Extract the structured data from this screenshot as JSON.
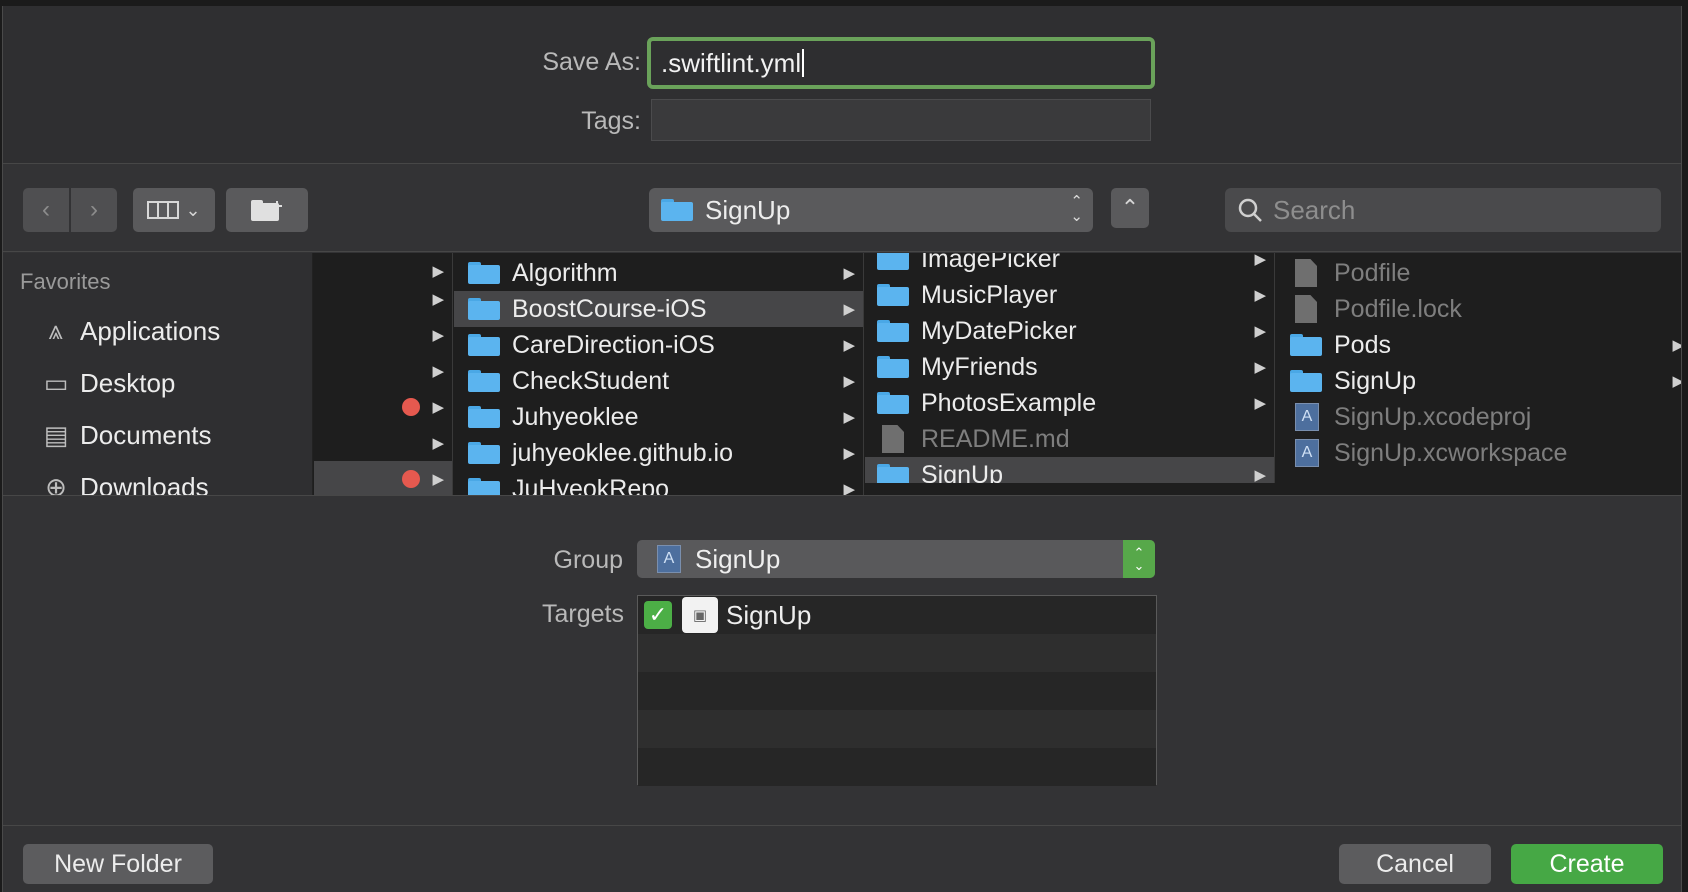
{
  "header": {
    "save_as_label": "Save As:",
    "save_as_value": ".swiftlint.yml",
    "tags_label": "Tags:"
  },
  "toolbar": {
    "back_icon": "chevron-left-icon",
    "forward_icon": "chevron-right-icon",
    "view_mode_icon": "column-view-icon",
    "new_folder_icon": "folder-add-icon",
    "location": "SignUp",
    "search_placeholder": "Search"
  },
  "sidebar": {
    "title": "Favorites",
    "items": [
      {
        "label": "Applications",
        "icon": "applications-icon"
      },
      {
        "label": "Desktop",
        "icon": "desktop-icon"
      },
      {
        "label": "Documents",
        "icon": "documents-icon"
      },
      {
        "label": "Downloads",
        "icon": "downloads-icon"
      }
    ]
  },
  "columns": {
    "col2": [
      {
        "label": "Algorithm"
      },
      {
        "label": "BoostCourse-iOS",
        "selected": true
      },
      {
        "label": "CareDirection-iOS"
      },
      {
        "label": "CheckStudent"
      },
      {
        "label": "Juhyeoklee"
      },
      {
        "label": "juhyeoklee.github.io"
      },
      {
        "label": "JuHyeokRepo"
      }
    ],
    "col3": [
      {
        "label": "ImagePicker"
      },
      {
        "label": "MusicPlayer"
      },
      {
        "label": "MyDatePicker"
      },
      {
        "label": "MyFriends"
      },
      {
        "label": "PhotosExample"
      },
      {
        "label": "README.md"
      },
      {
        "label": "SignUp",
        "selected": true
      }
    ],
    "col4": [
      {
        "label": "Podfile"
      },
      {
        "label": "Podfile.lock"
      },
      {
        "label": "Pods"
      },
      {
        "label": "SignUp"
      },
      {
        "label": "SignUp.xcodeproj"
      },
      {
        "label": "SignUp.xcworkspace"
      }
    ]
  },
  "options": {
    "group_label": "Group",
    "group_value": "SignUp",
    "targets_label": "Targets",
    "targets": [
      {
        "label": "SignUp",
        "checked": true
      }
    ]
  },
  "footer": {
    "new_folder": "New Folder",
    "cancel": "Cancel",
    "create": "Create"
  },
  "colors": {
    "accent_green": "#46a845",
    "focus_ring": "#6aa25a",
    "folder_blue": "#5bb4ef",
    "tag_red": "#e5594f"
  }
}
